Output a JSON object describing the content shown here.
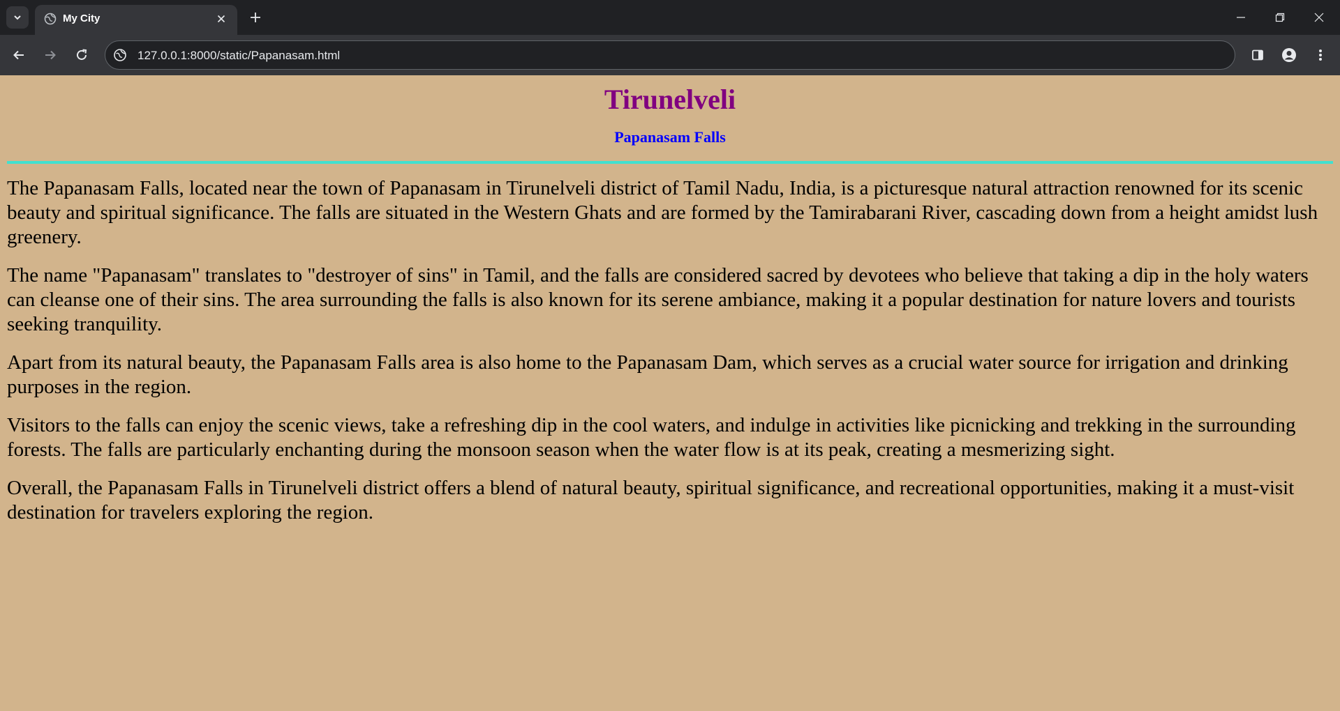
{
  "browser": {
    "tab": {
      "title": "My City"
    },
    "address_bar": {
      "url": "127.0.0.1:8000/static/Papanasam.html"
    }
  },
  "page": {
    "title": "Tirunelveli",
    "subtitle": "Papanasam Falls",
    "paragraphs": [
      "The Papanasam Falls, located near the town of Papanasam in Tirunelveli district of Tamil Nadu, India, is a picturesque natural attraction renowned for its scenic beauty and spiritual significance. The falls are situated in the Western Ghats and are formed by the Tamirabarani River, cascading down from a height amidst lush greenery.",
      "The name \"Papanasam\" translates to \"destroyer of sins\" in Tamil, and the falls are considered sacred by devotees who believe that taking a dip in the holy waters can cleanse one of their sins. The area surrounding the falls is also known for its serene ambiance, making it a popular destination for nature lovers and tourists seeking tranquility.",
      "Apart from its natural beauty, the Papanasam Falls area is also home to the Papanasam Dam, which serves as a crucial water source for irrigation and drinking purposes in the region.",
      "Visitors to the falls can enjoy the scenic views, take a refreshing dip in the cool waters, and indulge in activities like picnicking and trekking in the surrounding forests. The falls are particularly enchanting during the monsoon season when the water flow is at its peak, creating a mesmerizing sight.",
      "Overall, the Papanasam Falls in Tirunelveli district offers a blend of natural beauty, spiritual significance, and recreational opportunities, making it a must-visit destination for travelers exploring the region."
    ]
  },
  "colors": {
    "page_background": "#D2B48C",
    "title": "#800080",
    "subtitle": "#0000FF",
    "divider": "#40E0D0"
  },
  "icons": [
    "chevron-down-icon",
    "globe-icon",
    "close-icon",
    "plus-icon",
    "minimize-icon",
    "restore-icon",
    "close-window-icon",
    "back-arrow-icon",
    "forward-arrow-icon",
    "reload-icon",
    "site-info-icon",
    "side-panel-icon",
    "profile-icon",
    "more-vert-icon"
  ]
}
